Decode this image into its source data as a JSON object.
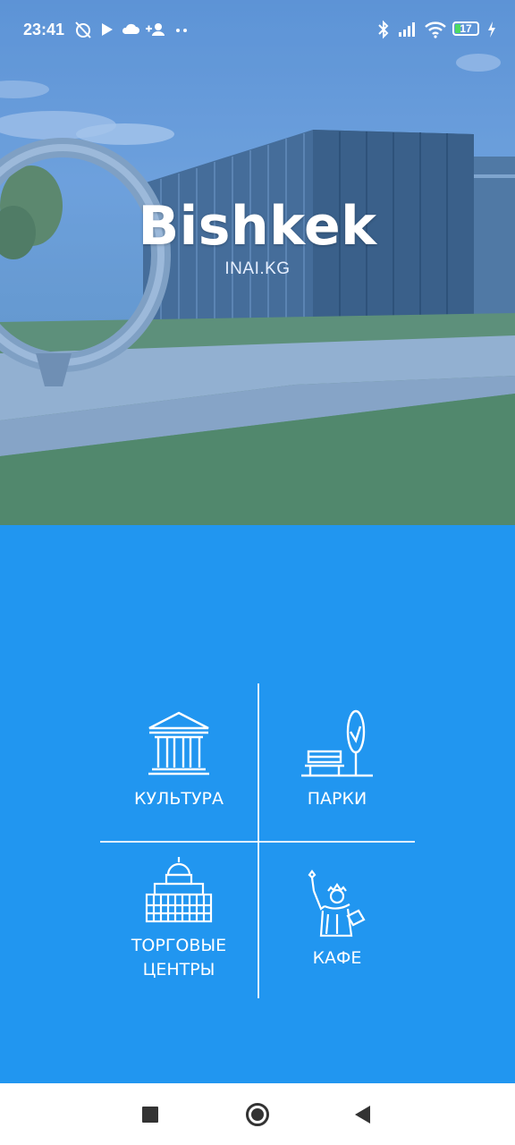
{
  "status_bar": {
    "time": "23:41",
    "battery_level": "17",
    "icons": [
      "alarm-off-icon",
      "play-icon",
      "cloud-icon",
      "add-person-icon",
      "more-dots-icon",
      "bluetooth-icon",
      "signal-icon",
      "wifi-icon",
      "battery-icon",
      "charging-icon"
    ]
  },
  "hero": {
    "title": "Bishkek",
    "subtitle": "INAI.KG"
  },
  "categories": [
    {
      "label": "КУЛЬТУРА",
      "icon": "museum-icon"
    },
    {
      "label": "ПАРКИ",
      "icon": "park-bench-icon"
    },
    {
      "label_line1": "ТОРГОВЫЕ",
      "label_line2": "ЦЕНТРЫ",
      "icon": "building-icon"
    },
    {
      "label": "КАФЕ",
      "icon": "statue-of-liberty-icon"
    }
  ],
  "nav_bar": {
    "buttons": [
      "recents-square-icon",
      "home-circle-icon",
      "back-triangle-icon"
    ]
  },
  "colors": {
    "primary_blue": "#2196f0",
    "white": "#ffffff"
  }
}
